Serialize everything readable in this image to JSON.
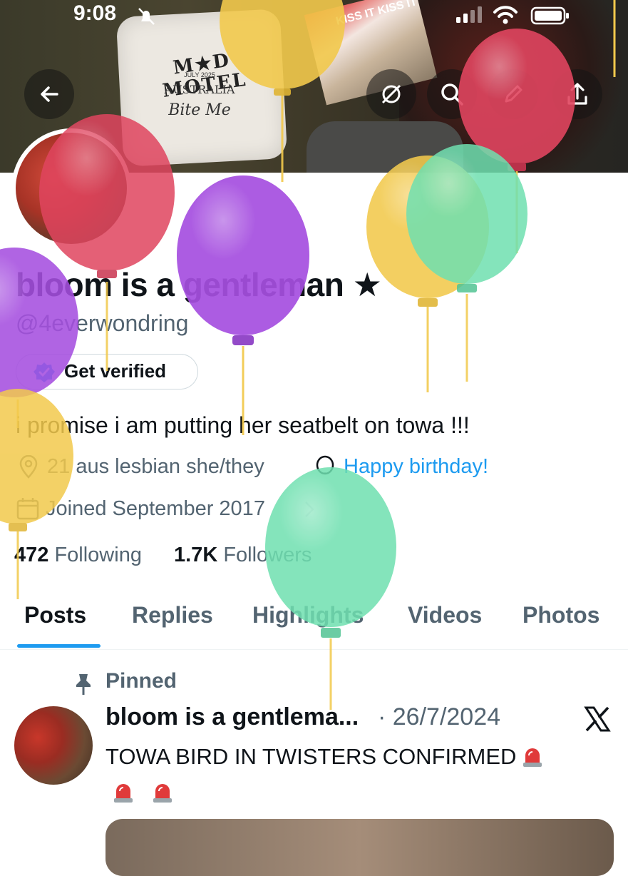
{
  "status_bar": {
    "time": "9:08"
  },
  "banner": {
    "pillow_title": "M★D MOTEL",
    "pillow_date": "JULY 2025",
    "pillow_location": "AUSTRALIA",
    "pillow_script": "Bite Me",
    "magazine_headline": "KISS IT KISS IT"
  },
  "profile": {
    "display_name": "bloom is a gentleman ★",
    "handle": "@4everwondring",
    "verify_label": "Get verified",
    "bio": "i promise i am putting her seatbelt on towa !!!",
    "location": "21 aus lesbian she/they",
    "birthday": "Happy birthday!",
    "joined": "Joined September 2017",
    "following_count": "472",
    "following_label": "Following",
    "followers_count": "1.7K",
    "followers_label": "Followers"
  },
  "tabs": [
    {
      "label": "Posts",
      "active": true
    },
    {
      "label": "Replies",
      "active": false
    },
    {
      "label": "Highlights",
      "active": false
    },
    {
      "label": "Videos",
      "active": false
    },
    {
      "label": "Photos",
      "active": false
    }
  ],
  "pinned_post": {
    "pinned_label": "Pinned",
    "author": "bloom is a gentlema...",
    "date": "· 26/7/2024",
    "text": "TOWA BIRD IN TWISTERS CONFIRMED"
  },
  "icons": [
    "back-arrow-icon",
    "no-sync-icon",
    "search-icon",
    "edit-pencil-icon",
    "share-icon",
    "location-pin-icon",
    "balloon-icon",
    "calendar-icon",
    "verified-badge-icon",
    "pin-icon",
    "x-logo-icon",
    "siren-emoji-icon"
  ],
  "colors": {
    "accent": "#1d9bf0",
    "text_primary": "#0f1419",
    "text_secondary": "#536471",
    "balloon_red": "#e0455f",
    "balloon_purple": "#a64fe0",
    "balloon_yellow": "#f2c94c",
    "balloon_green": "#6fe0b0"
  }
}
